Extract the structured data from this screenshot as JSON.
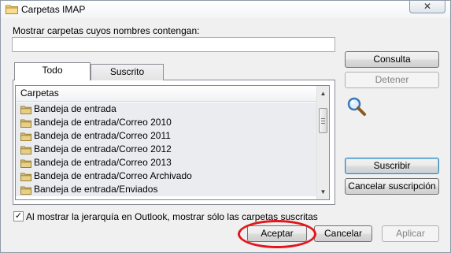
{
  "window": {
    "title": "Carpetas IMAP",
    "close_glyph": "✕"
  },
  "filter": {
    "label": "Mostrar carpetas cuyos nombres contengan:",
    "value": ""
  },
  "tabs": [
    {
      "label": "Todo",
      "selected": true
    },
    {
      "label": "Suscrito",
      "selected": false
    }
  ],
  "folder_list": {
    "header": "Carpetas",
    "items": [
      "Bandeja de entrada",
      "Bandeja de entrada/Correo 2010",
      "Bandeja de entrada/Correo 2011",
      "Bandeja de entrada/Correo 2012",
      "Bandeja de entrada/Correo 2013",
      "Bandeja de entrada/Correo Archivado",
      "Bandeja de entrada/Enviados"
    ]
  },
  "side_buttons": {
    "consulta": "Consulta",
    "detener": "Detener",
    "suscribir": "Suscribir",
    "cancelar_suscripcion": "Cancelar suscripción"
  },
  "hierarchy_option": {
    "label": "Al mostrar la jerarquía en Outlook, mostrar sólo las carpetas suscritas",
    "checked": true,
    "check_glyph": "✓"
  },
  "footer_buttons": {
    "aceptar": "Aceptar",
    "cancelar": "Cancelar",
    "aplicar": "Aplicar"
  },
  "icons": {
    "title": "folder-icon",
    "search": "magnifier-icon",
    "list_item": "folder-icon"
  },
  "colors": {
    "annotation_ring": "#e0161c",
    "default_button_border": "#3c7fb1"
  }
}
